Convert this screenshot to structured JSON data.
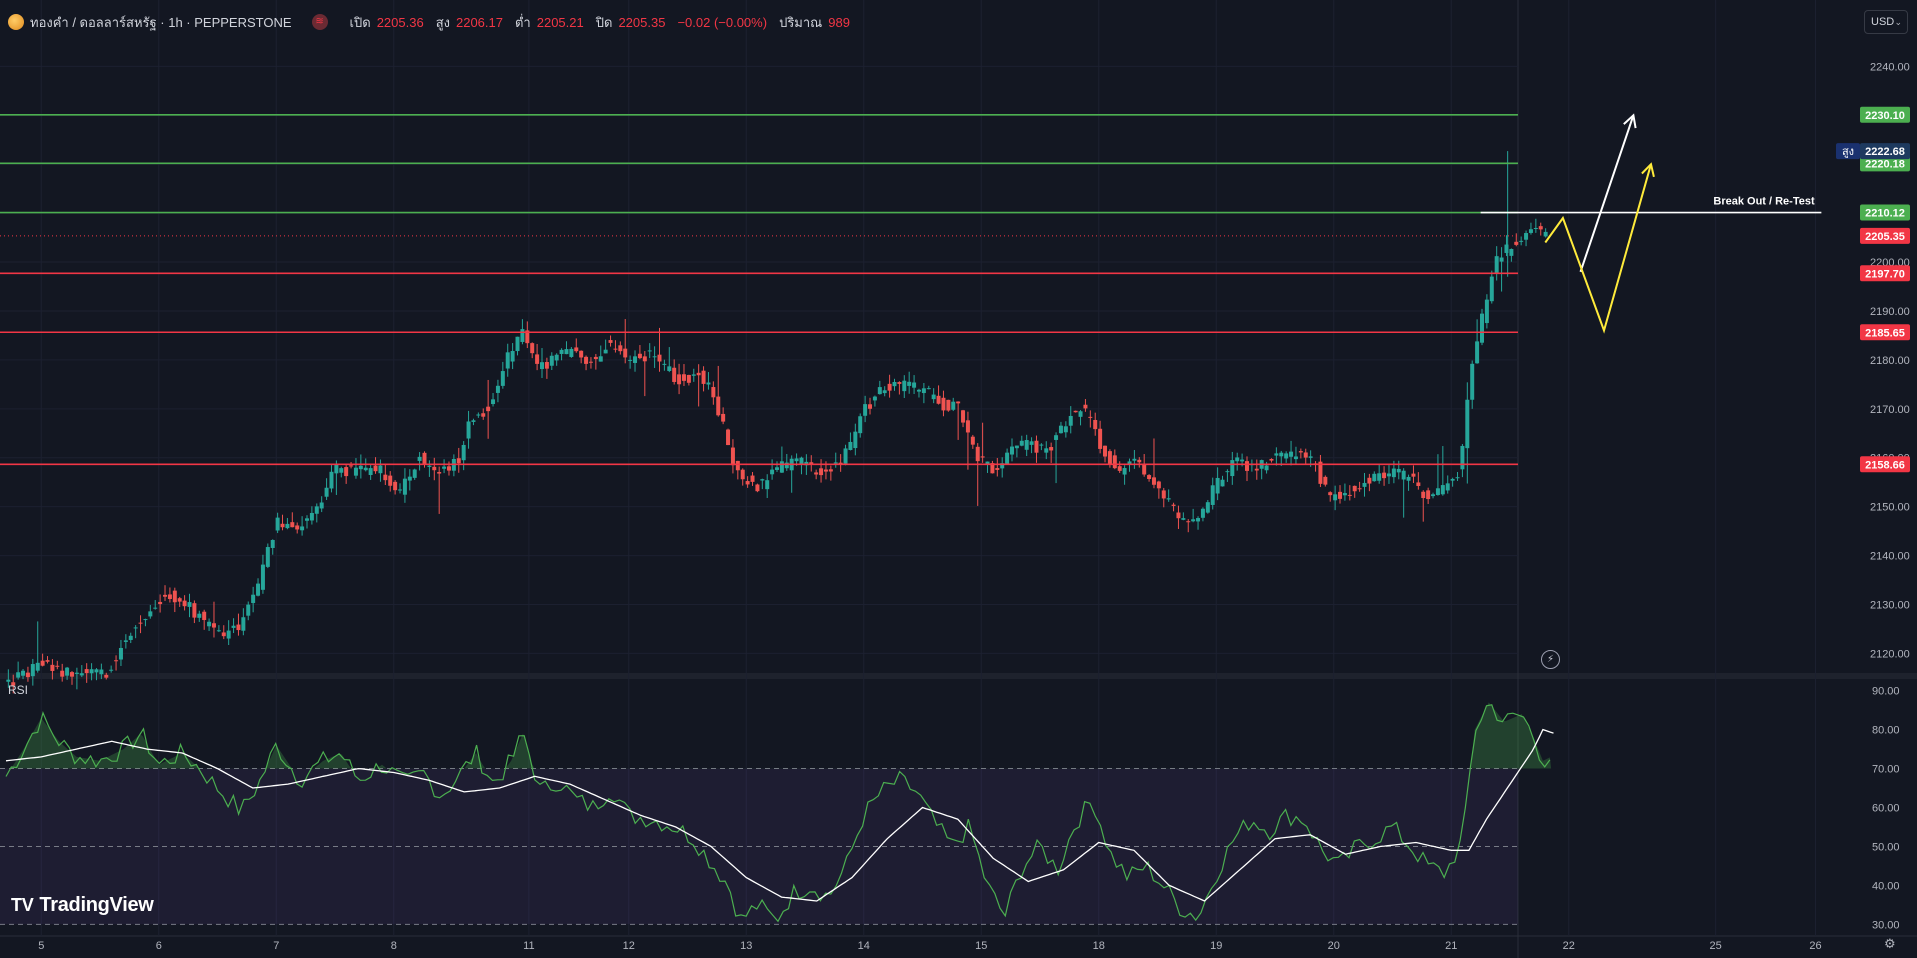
{
  "header": {
    "symbol": "ทองคำ / ดอลลาร์สหรัฐ · 1h · PEPPERSTONE",
    "market_icon": "≋",
    "open_label": "เปิด",
    "open": "2205.36",
    "high_label": "สูง",
    "high": "2206.17",
    "low_label": "ต่ำ",
    "low": "2205.21",
    "close_label": "ปิด",
    "close": "2205.35",
    "change": "−0.02 (−0.00%)",
    "volume_label": "ปริมาณ",
    "volume": "989"
  },
  "currency_button": {
    "label": "USD",
    "chevron": "⌄"
  },
  "rsi_title": "RSI",
  "brand": {
    "mark": "TV",
    "name": "TradingView"
  },
  "icons": {
    "settings": "gear-icon",
    "replay": "lightning-icon"
  },
  "colors": {
    "up": "#26a69a",
    "down": "#ef5350",
    "resistance": "#4caf50",
    "support": "#f23645",
    "rsi": "#4caf50",
    "rsi_ma": "#ffffff",
    "arrow_white": "#ffffff",
    "arrow_yellow": "#ffeb3b"
  },
  "chart_data": [
    {
      "type": "candlestick",
      "title": "ทองคำ / ดอลลาร์สหรัฐ · 1h · PEPPERSTONE",
      "y_range": [
        2116,
        2246
      ],
      "y_ticks": [
        2120,
        2130,
        2140,
        2150,
        2160,
        2170,
        2180,
        2190,
        2200,
        2240
      ],
      "x_ticks": [
        {
          "label": "5",
          "t": 0.3
        },
        {
          "label": "6",
          "t": 1.3
        },
        {
          "label": "7",
          "t": 2.3
        },
        {
          "label": "8",
          "t": 3.3
        },
        {
          "label": "11",
          "t": 4.45
        },
        {
          "label": "12",
          "t": 5.3
        },
        {
          "label": "13",
          "t": 6.3
        },
        {
          "label": "14",
          "t": 7.3
        },
        {
          "label": "15",
          "t": 8.3
        },
        {
          "label": "18",
          "t": 9.3
        },
        {
          "label": "19",
          "t": 10.3
        },
        {
          "label": "20",
          "t": 11.3
        },
        {
          "label": "21",
          "t": 12.3
        },
        {
          "label": "22",
          "t": 13.3
        },
        {
          "label": "25",
          "t": 14.55
        },
        {
          "label": "26",
          "t": 15.4
        }
      ],
      "price_levels": [
        {
          "value": 2230.1,
          "label": "2230.10",
          "kind": "resistance"
        },
        {
          "value": 2220.18,
          "label": "2220.18",
          "kind": "resistance"
        },
        {
          "value": 2210.12,
          "label": "2210.12",
          "kind": "resistance"
        },
        {
          "value": 2197.7,
          "label": "2197.70",
          "kind": "support"
        },
        {
          "value": 2185.65,
          "label": "2185.65",
          "kind": "support"
        },
        {
          "value": 2158.66,
          "label": "2158.66",
          "kind": "support"
        }
      ],
      "last_price": {
        "value": 2205.35,
        "label": "2205.35"
      },
      "high_marker": {
        "value": 2222.68,
        "label": "2222.68",
        "tag": "สูง"
      },
      "annotation": {
        "text": "Break Out / Re-Test",
        "value": 2210.12,
        "t_start": 12.55,
        "t_end": 15.45
      },
      "projection_white": [
        {
          "t": 13.4,
          "v": 2198
        },
        {
          "t": 13.85,
          "v": 2230
        }
      ],
      "projection_yellow": [
        {
          "t": 13.1,
          "v": 2204
        },
        {
          "t": 13.25,
          "v": 2209
        },
        {
          "t": 13.6,
          "v": 2186
        },
        {
          "t": 14.0,
          "v": 2220
        }
      ],
      "path": [
        {
          "t": 0.0,
          "v": 2113
        },
        {
          "t": 0.35,
          "v": 2118
        },
        {
          "t": 0.5,
          "v": 2116
        },
        {
          "t": 0.9,
          "v": 2116
        },
        {
          "t": 1.05,
          "v": 2123
        },
        {
          "t": 1.2,
          "v": 2127
        },
        {
          "t": 1.4,
          "v": 2132
        },
        {
          "t": 1.55,
          "v": 2131
        },
        {
          "t": 1.7,
          "v": 2127
        },
        {
          "t": 1.9,
          "v": 2124
        },
        {
          "t": 2.05,
          "v": 2126
        },
        {
          "t": 2.2,
          "v": 2135
        },
        {
          "t": 2.35,
          "v": 2147
        },
        {
          "t": 2.5,
          "v": 2145
        },
        {
          "t": 2.7,
          "v": 2150
        },
        {
          "t": 2.85,
          "v": 2158
        },
        {
          "t": 3.0,
          "v": 2157
        },
        {
          "t": 3.2,
          "v": 2158
        },
        {
          "t": 3.4,
          "v": 2153
        },
        {
          "t": 3.55,
          "v": 2160
        },
        {
          "t": 3.75,
          "v": 2157
        },
        {
          "t": 3.9,
          "v": 2160
        },
        {
          "t": 4.0,
          "v": 2168
        },
        {
          "t": 4.15,
          "v": 2170
        },
        {
          "t": 4.3,
          "v": 2180
        },
        {
          "t": 4.45,
          "v": 2187
        },
        {
          "t": 4.55,
          "v": 2178
        },
        {
          "t": 4.7,
          "v": 2180
        },
        {
          "t": 4.85,
          "v": 2182
        },
        {
          "t": 5.0,
          "v": 2179
        },
        {
          "t": 5.15,
          "v": 2183
        },
        {
          "t": 5.35,
          "v": 2180
        },
        {
          "t": 5.55,
          "v": 2181
        },
        {
          "t": 5.75,
          "v": 2176
        },
        {
          "t": 5.95,
          "v": 2177
        },
        {
          "t": 6.05,
          "v": 2173
        },
        {
          "t": 6.15,
          "v": 2166
        },
        {
          "t": 6.25,
          "v": 2157
        },
        {
          "t": 6.45,
          "v": 2154
        },
        {
          "t": 6.6,
          "v": 2158
        },
        {
          "t": 6.8,
          "v": 2159
        },
        {
          "t": 7.0,
          "v": 2157
        },
        {
          "t": 7.2,
          "v": 2161
        },
        {
          "t": 7.35,
          "v": 2170
        },
        {
          "t": 7.5,
          "v": 2174
        },
        {
          "t": 7.7,
          "v": 2175
        },
        {
          "t": 7.85,
          "v": 2174
        },
        {
          "t": 8.0,
          "v": 2171
        },
        {
          "t": 8.15,
          "v": 2170
        },
        {
          "t": 8.3,
          "v": 2160
        },
        {
          "t": 8.45,
          "v": 2157
        },
        {
          "t": 8.6,
          "v": 2162
        },
        {
          "t": 8.75,
          "v": 2163
        },
        {
          "t": 8.9,
          "v": 2161
        },
        {
          "t": 9.05,
          "v": 2167
        },
        {
          "t": 9.2,
          "v": 2171
        },
        {
          "t": 9.35,
          "v": 2163
        },
        {
          "t": 9.5,
          "v": 2157
        },
        {
          "t": 9.65,
          "v": 2159
        },
        {
          "t": 9.8,
          "v": 2156
        },
        {
          "t": 9.95,
          "v": 2150
        },
        {
          "t": 10.05,
          "v": 2147
        },
        {
          "t": 10.2,
          "v": 2148
        },
        {
          "t": 10.35,
          "v": 2155
        },
        {
          "t": 10.5,
          "v": 2159
        },
        {
          "t": 10.7,
          "v": 2158
        },
        {
          "t": 10.85,
          "v": 2160
        },
        {
          "t": 11.0,
          "v": 2161
        },
        {
          "t": 11.15,
          "v": 2160
        },
        {
          "t": 11.3,
          "v": 2152
        },
        {
          "t": 11.45,
          "v": 2153
        },
        {
          "t": 11.6,
          "v": 2155
        },
        {
          "t": 11.8,
          "v": 2157
        },
        {
          "t": 12.0,
          "v": 2156
        },
        {
          "t": 12.15,
          "v": 2151
        },
        {
          "t": 12.3,
          "v": 2154
        },
        {
          "t": 12.42,
          "v": 2158
        },
        {
          "t": 12.5,
          "v": 2177
        },
        {
          "t": 12.6,
          "v": 2188
        },
        {
          "t": 12.72,
          "v": 2201
        },
        {
          "t": 12.85,
          "v": 2203
        },
        {
          "t": 12.95,
          "v": 2205
        },
        {
          "t": 13.05,
          "v": 2207
        },
        {
          "t": 13.12,
          "v": 2205.35
        }
      ]
    },
    {
      "type": "line",
      "title": "RSI",
      "y_range": [
        27,
        93
      ],
      "y_ticks": [
        30,
        40,
        50,
        60,
        70,
        80,
        90
      ],
      "overbought": 70,
      "midline": 50,
      "oversold": 30,
      "series": [
        {
          "role": "rsi",
          "values": [
            {
              "t": 0.0,
              "v": 68
            },
            {
              "t": 0.15,
              "v": 75
            },
            {
              "t": 0.3,
              "v": 83
            },
            {
              "t": 0.45,
              "v": 77
            },
            {
              "t": 0.6,
              "v": 73
            },
            {
              "t": 0.8,
              "v": 72
            },
            {
              "t": 1.0,
              "v": 75
            },
            {
              "t": 1.15,
              "v": 79
            },
            {
              "t": 1.3,
              "v": 71
            },
            {
              "t": 1.5,
              "v": 74
            },
            {
              "t": 1.65,
              "v": 70
            },
            {
              "t": 1.8,
              "v": 65
            },
            {
              "t": 2.0,
              "v": 59
            },
            {
              "t": 2.15,
              "v": 66
            },
            {
              "t": 2.3,
              "v": 76
            },
            {
              "t": 2.5,
              "v": 67
            },
            {
              "t": 2.7,
              "v": 72
            },
            {
              "t": 2.85,
              "v": 74
            },
            {
              "t": 3.0,
              "v": 67
            },
            {
              "t": 3.2,
              "v": 71
            },
            {
              "t": 3.4,
              "v": 66
            },
            {
              "t": 3.55,
              "v": 69
            },
            {
              "t": 3.7,
              "v": 63
            },
            {
              "t": 3.85,
              "v": 68
            },
            {
              "t": 4.0,
              "v": 74
            },
            {
              "t": 4.15,
              "v": 66
            },
            {
              "t": 4.3,
              "v": 72
            },
            {
              "t": 4.4,
              "v": 79
            },
            {
              "t": 4.55,
              "v": 64
            },
            {
              "t": 4.7,
              "v": 67
            },
            {
              "t": 4.85,
              "v": 62
            },
            {
              "t": 5.0,
              "v": 60
            },
            {
              "t": 5.15,
              "v": 65
            },
            {
              "t": 5.3,
              "v": 58
            },
            {
              "t": 5.5,
              "v": 57
            },
            {
              "t": 5.7,
              "v": 55
            },
            {
              "t": 5.85,
              "v": 52
            },
            {
              "t": 6.0,
              "v": 46
            },
            {
              "t": 6.15,
              "v": 40
            },
            {
              "t": 6.25,
              "v": 31
            },
            {
              "t": 6.4,
              "v": 35
            },
            {
              "t": 6.55,
              "v": 31
            },
            {
              "t": 6.7,
              "v": 38
            },
            {
              "t": 6.85,
              "v": 40
            },
            {
              "t": 7.0,
              "v": 37
            },
            {
              "t": 7.15,
              "v": 45
            },
            {
              "t": 7.3,
              "v": 58
            },
            {
              "t": 7.45,
              "v": 64
            },
            {
              "t": 7.6,
              "v": 67
            },
            {
              "t": 7.75,
              "v": 64
            },
            {
              "t": 7.9,
              "v": 56
            },
            {
              "t": 8.05,
              "v": 50
            },
            {
              "t": 8.2,
              "v": 55
            },
            {
              "t": 8.35,
              "v": 40
            },
            {
              "t": 8.5,
              "v": 32
            },
            {
              "t": 8.65,
              "v": 45
            },
            {
              "t": 8.8,
              "v": 50
            },
            {
              "t": 8.95,
              "v": 44
            },
            {
              "t": 9.1,
              "v": 56
            },
            {
              "t": 9.25,
              "v": 62
            },
            {
              "t": 9.4,
              "v": 48
            },
            {
              "t": 9.55,
              "v": 42
            },
            {
              "t": 9.7,
              "v": 45
            },
            {
              "t": 9.85,
              "v": 40
            },
            {
              "t": 10.0,
              "v": 34
            },
            {
              "t": 10.15,
              "v": 32
            },
            {
              "t": 10.3,
              "v": 43
            },
            {
              "t": 10.45,
              "v": 52
            },
            {
              "t": 10.6,
              "v": 57
            },
            {
              "t": 10.75,
              "v": 54
            },
            {
              "t": 10.9,
              "v": 58
            },
            {
              "t": 11.05,
              "v": 57
            },
            {
              "t": 11.2,
              "v": 49
            },
            {
              "t": 11.35,
              "v": 45
            },
            {
              "t": 11.5,
              "v": 50
            },
            {
              "t": 11.65,
              "v": 52
            },
            {
              "t": 11.8,
              "v": 55
            },
            {
              "t": 11.95,
              "v": 50
            },
            {
              "t": 12.1,
              "v": 45
            },
            {
              "t": 12.25,
              "v": 43
            },
            {
              "t": 12.4,
              "v": 52
            },
            {
              "t": 12.5,
              "v": 80
            },
            {
              "t": 12.62,
              "v": 87
            },
            {
              "t": 12.75,
              "v": 82
            },
            {
              "t": 12.9,
              "v": 84
            },
            {
              "t": 13.0,
              "v": 78
            },
            {
              "t": 13.08,
              "v": 72
            },
            {
              "t": 13.15,
              "v": 73
            }
          ]
        },
        {
          "role": "rsi_ma",
          "values": [
            {
              "t": 0.0,
              "v": 72
            },
            {
              "t": 0.3,
              "v": 73
            },
            {
              "t": 0.6,
              "v": 75
            },
            {
              "t": 0.9,
              "v": 77
            },
            {
              "t": 1.2,
              "v": 75
            },
            {
              "t": 1.5,
              "v": 74
            },
            {
              "t": 1.8,
              "v": 70
            },
            {
              "t": 2.1,
              "v": 65
            },
            {
              "t": 2.4,
              "v": 66
            },
            {
              "t": 2.7,
              "v": 68
            },
            {
              "t": 3.0,
              "v": 70
            },
            {
              "t": 3.3,
              "v": 69
            },
            {
              "t": 3.6,
              "v": 67
            },
            {
              "t": 3.9,
              "v": 64
            },
            {
              "t": 4.2,
              "v": 65
            },
            {
              "t": 4.5,
              "v": 68
            },
            {
              "t": 4.8,
              "v": 66
            },
            {
              "t": 5.1,
              "v": 62
            },
            {
              "t": 5.4,
              "v": 58
            },
            {
              "t": 5.7,
              "v": 55
            },
            {
              "t": 6.0,
              "v": 50
            },
            {
              "t": 6.3,
              "v": 42
            },
            {
              "t": 6.6,
              "v": 37
            },
            {
              "t": 6.9,
              "v": 36
            },
            {
              "t": 7.2,
              "v": 42
            },
            {
              "t": 7.5,
              "v": 52
            },
            {
              "t": 7.8,
              "v": 60
            },
            {
              "t": 8.1,
              "v": 57
            },
            {
              "t": 8.4,
              "v": 47
            },
            {
              "t": 8.7,
              "v": 41
            },
            {
              "t": 9.0,
              "v": 44
            },
            {
              "t": 9.3,
              "v": 51
            },
            {
              "t": 9.6,
              "v": 49
            },
            {
              "t": 9.9,
              "v": 40
            },
            {
              "t": 10.2,
              "v": 36
            },
            {
              "t": 10.5,
              "v": 44
            },
            {
              "t": 10.8,
              "v": 52
            },
            {
              "t": 11.1,
              "v": 53
            },
            {
              "t": 11.4,
              "v": 48
            },
            {
              "t": 11.7,
              "v": 50
            },
            {
              "t": 12.0,
              "v": 51
            },
            {
              "t": 12.3,
              "v": 49
            },
            {
              "t": 12.45,
              "v": 49
            },
            {
              "t": 12.6,
              "v": 57
            },
            {
              "t": 12.8,
              "v": 66
            },
            {
              "t": 13.0,
              "v": 75
            },
            {
              "t": 13.08,
              "v": 80
            },
            {
              "t": 13.18,
              "v": 79
            }
          ]
        }
      ]
    }
  ]
}
